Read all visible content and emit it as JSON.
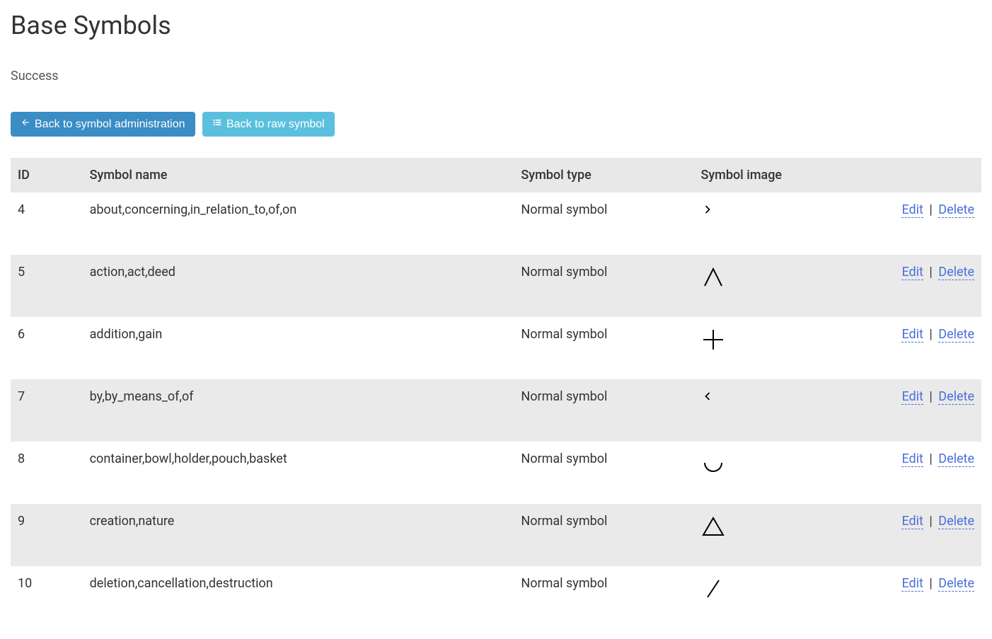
{
  "page": {
    "title": "Base Symbols",
    "status": "Success"
  },
  "buttons": {
    "back_admin": "Back to symbol administration",
    "back_raw": "Back to raw symbol"
  },
  "table": {
    "headers": {
      "id": "ID",
      "name": "Symbol name",
      "type": "Symbol type",
      "image": "Symbol image",
      "actions": ""
    },
    "action_labels": {
      "edit": "Edit",
      "delete": "Delete",
      "sep": "|"
    },
    "rows": [
      {
        "id": "4",
        "name": "about,concerning,in_relation_to,of,on",
        "type": "Normal symbol",
        "glyph": "chevron-right"
      },
      {
        "id": "5",
        "name": "action,act,deed",
        "type": "Normal symbol",
        "glyph": "caret-up"
      },
      {
        "id": "6",
        "name": "addition,gain",
        "type": "Normal symbol",
        "glyph": "plus"
      },
      {
        "id": "7",
        "name": "by,by_means_of,of",
        "type": "Normal symbol",
        "glyph": "chevron-left"
      },
      {
        "id": "8",
        "name": "container,bowl,holder,pouch,basket",
        "type": "Normal symbol",
        "glyph": "cup"
      },
      {
        "id": "9",
        "name": "creation,nature",
        "type": "Normal symbol",
        "glyph": "triangle"
      },
      {
        "id": "10",
        "name": "deletion,cancellation,destruction",
        "type": "Normal symbol",
        "glyph": "slash"
      }
    ]
  }
}
